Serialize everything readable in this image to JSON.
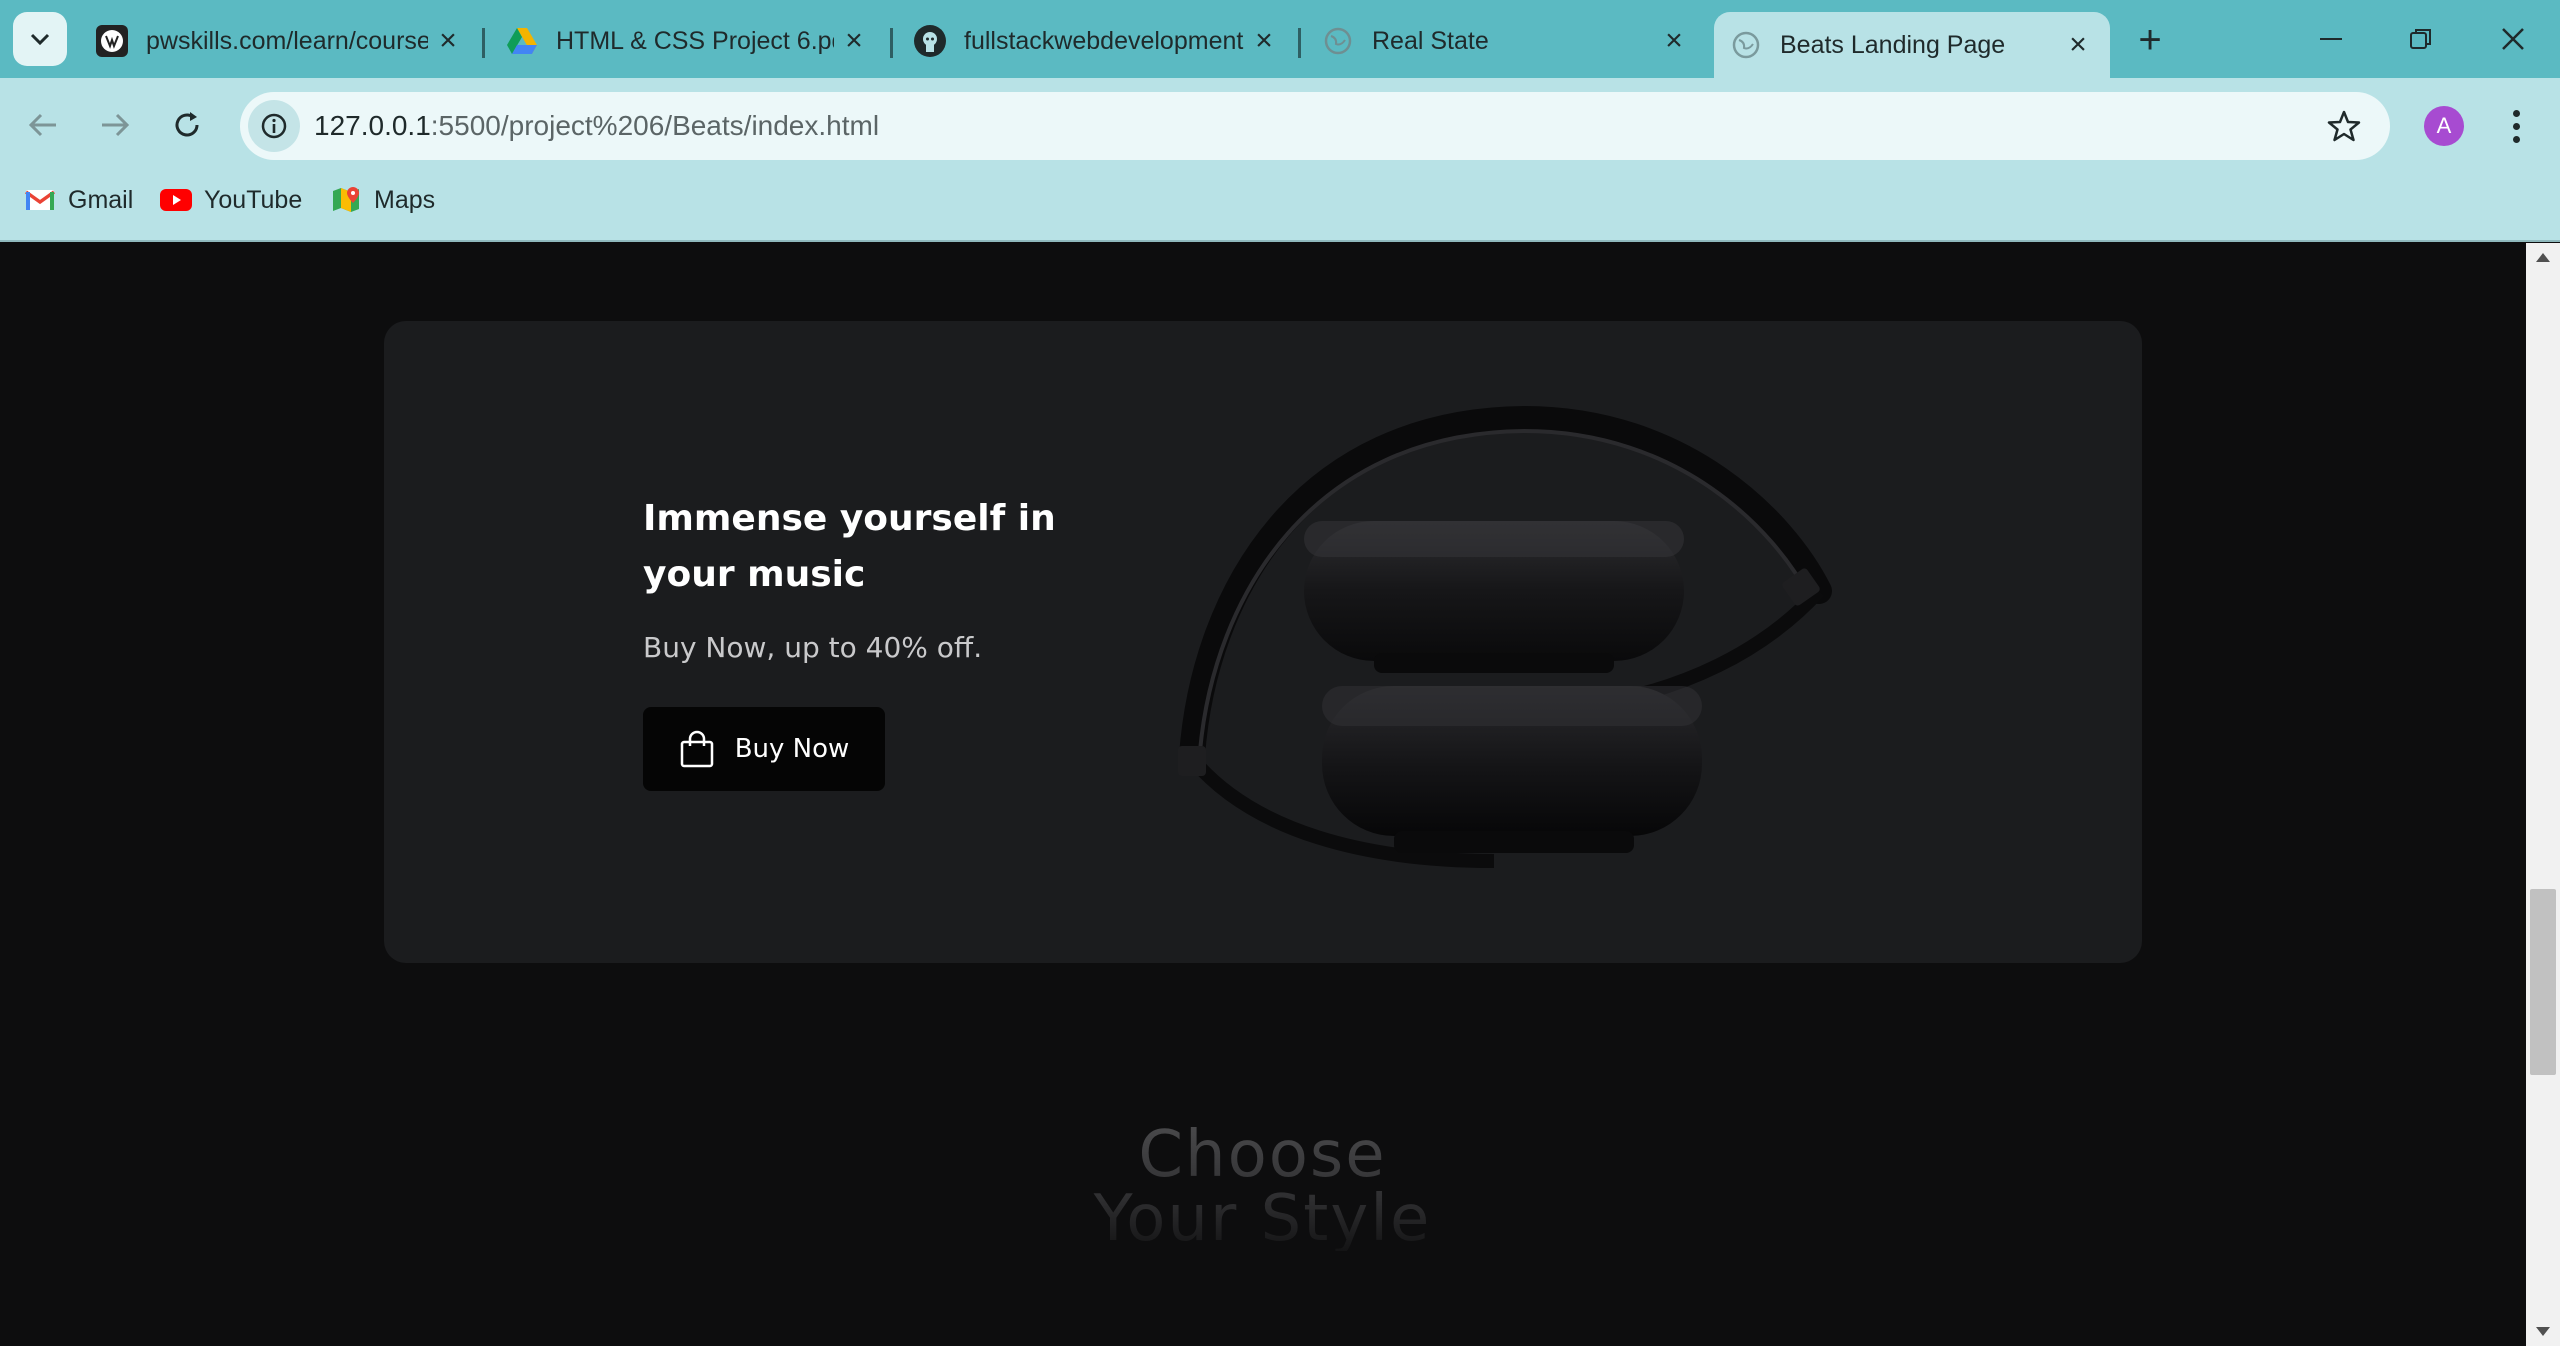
{
  "browser": {
    "tabs": [
      {
        "title": "pwskills.com/learn/course",
        "icon": "pwskills-icon"
      },
      {
        "title": "HTML & CSS Project 6.pdf",
        "icon": "google-drive-icon"
      },
      {
        "title": "fullstackwebdevelopment",
        "icon": "github-icon"
      },
      {
        "title": "Real State",
        "icon": "globe-icon"
      },
      {
        "title": "Beats Landing Page",
        "icon": "globe-icon",
        "active": true
      }
    ],
    "address": {
      "host": "127.0.0.1",
      "path": ":5500/project%206/Beats/index.html"
    },
    "profile_initial": "A",
    "bookmarks": [
      {
        "label": "Gmail",
        "icon": "gmail-icon"
      },
      {
        "label": "YouTube",
        "icon": "youtube-icon"
      },
      {
        "label": "Maps",
        "icon": "maps-icon"
      }
    ],
    "colors": {
      "frame": "#5bbac2",
      "toolbar": "#b8e2e6",
      "avatar": "#a74bd1"
    }
  },
  "page": {
    "promo": {
      "heading": "Immense yourself in your music",
      "subtext": "Buy Now, up to 40% off.",
      "button_label": "Buy Now"
    },
    "section_title_line1": "Choose",
    "section_title_line2": "Your Style",
    "colors": {
      "background": "#0d0d0e",
      "card": "#1b1c1e",
      "button": "#050505"
    }
  }
}
